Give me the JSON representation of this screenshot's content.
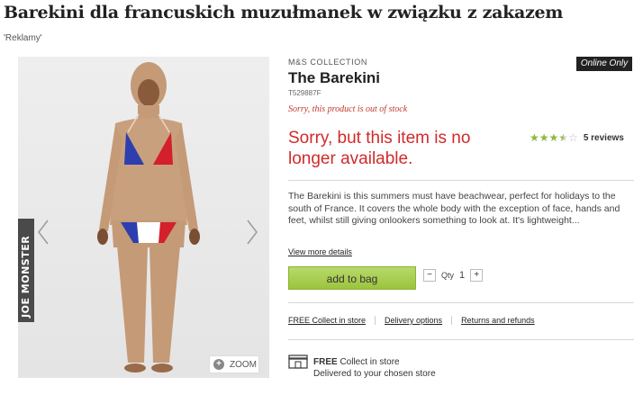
{
  "article": {
    "headline": "Barekini dla francuskich muzułmanek w związku z zakazem",
    "tag": "'Reklamy'"
  },
  "gallery": {
    "watermark": "JOE MONSTER",
    "zoom_label": "ZOOM"
  },
  "product": {
    "collection": "M&S COLLECTION",
    "badge": "Online Only",
    "title": "The Barekini",
    "sku": "T529887F",
    "out_of_stock": "Sorry, this product is out of stock",
    "unavailable_line1": "Sorry, but this item is no",
    "unavailable_line2": "longer available.",
    "rating_value": 3.5,
    "rating_max": 5,
    "reviews": "5 reviews",
    "description": "The Barekini is this summers must have beachwear, perfect for holidays to the south of France. It covers the whole body with the exception of face, hands and feet, whilst still giving onlookers something to look at. It's lightweight...",
    "view_more": "View more details",
    "add_to_bag": "add to bag",
    "qty_label": "Qty",
    "qty_value": "1",
    "qty_minus": "−",
    "qty_plus": "+"
  },
  "delivery_links": {
    "collect": "FREE Collect in store",
    "delivery": "Delivery options",
    "returns": "Returns and refunds"
  },
  "collect_info": {
    "free": "FREE",
    "line1_rest": " Collect in store",
    "line2": "Delivered to your chosen store"
  },
  "colors": {
    "sale_red": "#d22a2a",
    "button_green": "#9cc43e",
    "star_green": "#8fb83a"
  }
}
